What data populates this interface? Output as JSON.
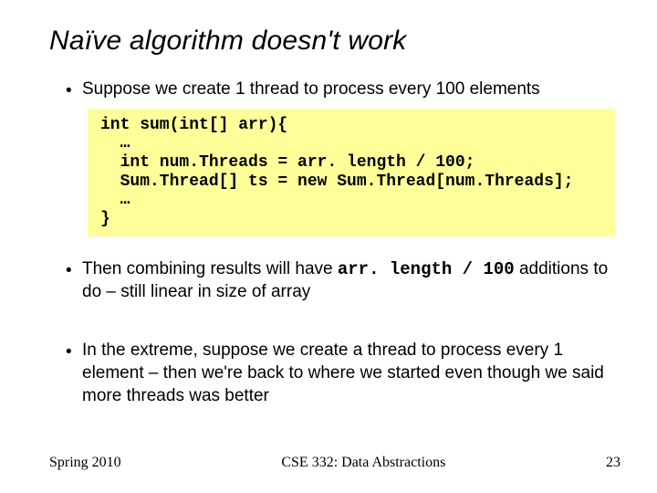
{
  "title": "Naïve algorithm doesn't work",
  "bullets": {
    "b1": "Suppose we create 1 thread to process every 100 elements",
    "b2_pre": "Then combining results will have ",
    "b2_code": "arr. length / 100",
    "b2_post": " additions to do – still linear in size of array",
    "b3": "In the extreme, suppose we create a thread to process every 1 element – then we're back to where we started even though we said more threads was better"
  },
  "code": "int sum(int[] arr){\n  …\n  int num.Threads = arr. length / 100;\n  Sum.Thread[] ts = new Sum.Thread[num.Threads];\n  …\n}",
  "footer": {
    "left": "Spring 2010",
    "mid": "CSE 332: Data Abstractions",
    "right": "23"
  },
  "dot": "•"
}
